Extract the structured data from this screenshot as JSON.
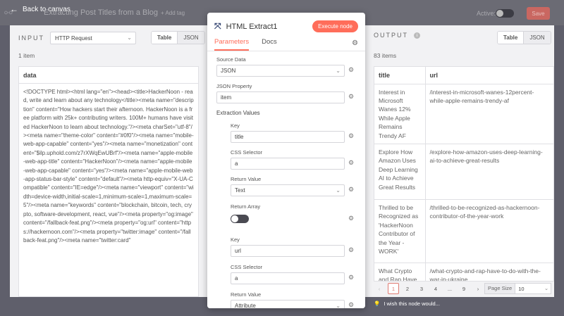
{
  "topbar": {
    "back_label": "Back to canvas",
    "workflow_name": "Extracting Post Titles from a Blog",
    "add_tag": "+ Add tag",
    "active_label": "Active:",
    "save_label": "Save"
  },
  "input_panel": {
    "label": "INPUT",
    "source_select": "HTTP Request",
    "view_table": "Table",
    "view_json": "JSON",
    "count": "1 item",
    "column": "data",
    "cell": "<!DOCTYPE html><html lang=\"en\"><head><title>HackerNoon - read, write and learn about any technology</title><meta name=\"description\" content=\"How hackers start their afternoon. HackerNoon is a free platform with 25k+ contributing writers. 100M+ humans have visited HackerNoon to learn about technology.\"/><meta charSet=\"utf-8\"/><meta name=\"theme-color\" content=\"#0f0\"/><meta name=\"mobile-web-app-capable\" content=\"yes\"/><meta name=\"monetization\" content=\"$ilp.uphold.com/z7rXWqEwUBrf\"/><meta name=\"apple-mobile-web-app-title\" content=\"HackerNoon\"/><meta name=\"apple-mobile-web-app-capable\" content=\"yes\"/><meta name=\"apple-mobile-web-app-status-bar-style\" content=\"default\"/><meta http-equiv=\"X-UA-Compatible\" content=\"IE=edge\"/><meta name=\"viewport\" content=\"width=device-width,initial-scale=1,minimum-scale=1,maximum-scale=5\"/><meta name=\"keywords\" content=\"blockchain, bitcoin, tech, crypto, software-development, react, vue\"/><meta property=\"og:image\" content=\"/fallback-feat.png\"/><meta property=\"og:url\" content=\"https://hackernoon.com\"/><meta property=\"twitter:image\" content=\"/fallback-feat.png\"/><meta name=\"twitter:card\""
  },
  "node": {
    "title": "HTML Extract1",
    "execute_label": "Execute node",
    "tab_parameters": "Parameters",
    "tab_docs": "Docs",
    "source_data_label": "Source Data",
    "source_data_value": "JSON",
    "json_property_label": "JSON Property",
    "json_property_value": "item",
    "extraction_values_label": "Extraction Values",
    "key_label": "Key",
    "key1_value": "title",
    "css_selector_label": "CSS Selector",
    "css1_value": "a",
    "return_value_label": "Return Value",
    "return1_value": "Text",
    "return_array_label": "Return Array",
    "key2_value": "url",
    "css2_value": "a",
    "return2_value": "Attribute"
  },
  "output_panel": {
    "label": "OUTPUT",
    "view_table": "Table",
    "view_json": "JSON",
    "count": "83 items",
    "columns": [
      "title",
      "url"
    ],
    "rows": [
      {
        "title": "Interest in Microsoft Wanes 12% While Apple Remains Trendy AF",
        "url": "/interest-in-microsoft-wanes-12percent-while-apple-remains-trendy-af"
      },
      {
        "title": "Explore How Amazon Uses Deep Learning AI to Achieve Great Results",
        "url": "/explore-how-amazon-uses-deep-learning-ai-to-achieve-great-results"
      },
      {
        "title": "Thrilled to be Recognized as 'HackerNoon Contributor of the Year - WORK'",
        "url": "/thrilled-to-be-recognized-as-hackernoon-contributor-of-the-year-work"
      },
      {
        "title": "What Crypto and Rap Have",
        "url": "/what-crypto-and-rap-have-to-do-with-the-war-in-ukraine"
      }
    ],
    "pages": [
      "1",
      "2",
      "3",
      "4",
      "...",
      "9"
    ],
    "page_size_label": "Page Size",
    "page_size_value": "10"
  },
  "wish_label": "I wish this node would..."
}
